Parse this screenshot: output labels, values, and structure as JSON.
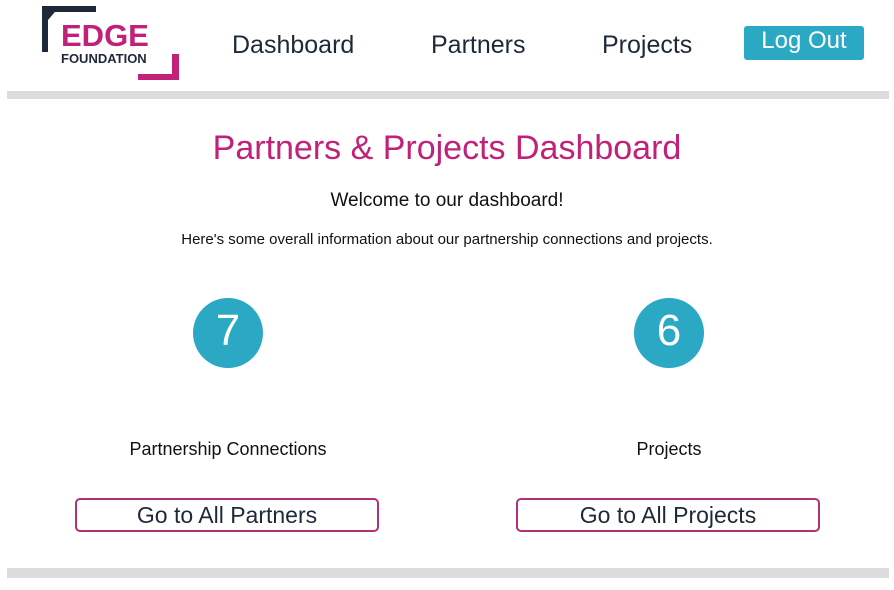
{
  "header": {
    "logo": {
      "line1": "EDGE",
      "line2": "FOUNDATION"
    },
    "nav": [
      {
        "label": "Dashboard"
      },
      {
        "label": "Partners"
      },
      {
        "label": "Projects"
      }
    ],
    "logout_label": "Log Out"
  },
  "main": {
    "title": "Partners & Projects Dashboard",
    "welcome": "Welcome to our dashboard!",
    "description": "Here's some overall information about our partnership connections and projects.",
    "stats": [
      {
        "count": "7",
        "label": "Partnership Connections",
        "button": "Go to All Partners"
      },
      {
        "count": "6",
        "label": "Projects",
        "button": "Go to All Projects"
      }
    ]
  },
  "colors": {
    "accent": "#c2217a",
    "teal": "#2ba8c4",
    "navy": "#1d2939",
    "divider": "#dcdcdc"
  }
}
